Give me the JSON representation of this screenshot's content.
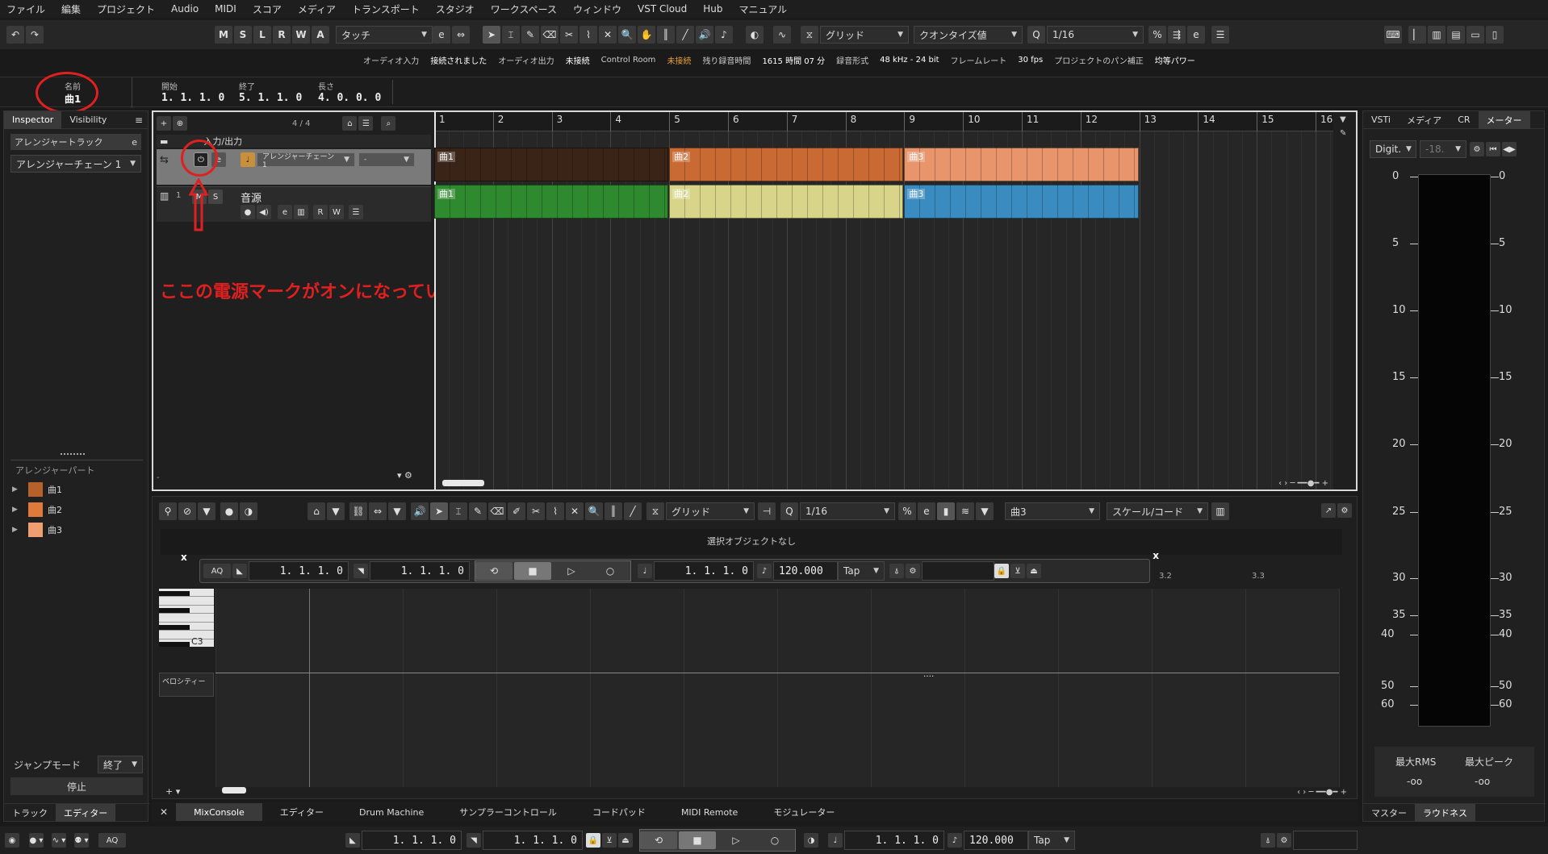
{
  "menu": [
    "ファイル",
    "編集",
    "プロジェクト",
    "Audio",
    "MIDI",
    "スコア",
    "メディア",
    "トランスポート",
    "スタジオ",
    "ワークスペース",
    "ウィンドウ",
    "VST Cloud",
    "Hub",
    "マニュアル"
  ],
  "toolbar": {
    "msrwa": [
      "M",
      "S",
      "L",
      "R",
      "W",
      "A"
    ],
    "touch": "タッチ",
    "grid": "グリッド",
    "quantize_type": "クオンタイズ値",
    "quantize": "1/16"
  },
  "status": {
    "audio_in_label": "オーディオ入力",
    "audio_in_value": "接続されました",
    "audio_out_label": "オーディオ出力",
    "audio_out_value": "未接続",
    "cr_label": "Control Room",
    "cr_value": "未接続",
    "rec_time_label": "残り録音時間",
    "rec_time_value": "1615 時間 07 分",
    "rec_format_label": "録音形式",
    "rec_format_value": "48 kHz - 24 bit",
    "frame_label": "フレームレート",
    "frame_value": "30 fps",
    "pan_label": "プロジェクトのパン補正",
    "pan_value": "均等パワー"
  },
  "infoline": {
    "name_label": "名前",
    "name_value": "曲1",
    "start_label": "開始",
    "start_value": "1. 1. 1.  0",
    "end_label": "終了",
    "end_value": "5. 1. 1.  0",
    "length_label": "長さ",
    "length_value": "4. 0. 0.  0"
  },
  "inspector": {
    "tab1": "Inspector",
    "tab2": "Visibility",
    "track_name": "アレンジャートラック",
    "chain": "アレンジャーチェーン 1",
    "parts_title": "アレンジャーパート",
    "parts": [
      "曲1",
      "曲2",
      "曲3"
    ],
    "part_colors": [
      "#b8602a",
      "#e07a3a",
      "#f0a070"
    ],
    "jump_label": "ジャンプモード",
    "jump_value": "終了",
    "stop": "停止",
    "bottom_tab1": "トラック",
    "bottom_tab2": "エディター"
  },
  "tracklist": {
    "counter": "4 / 4",
    "io_label": "入力/出力",
    "arranger_chain": "アレンジャーチェーン 1",
    "arranger_dash": "-",
    "track_num": "1",
    "track_name": "音源",
    "btn_m": "M",
    "btn_s": "S",
    "btn_r": "R",
    "btn_w": "W"
  },
  "ruler": [
    "1",
    "2",
    "3",
    "4",
    "5",
    "6",
    "7",
    "8",
    "9",
    "10",
    "11",
    "12",
    "13",
    "14",
    "15",
    "16"
  ],
  "clips_arranger": [
    {
      "label": "曲1",
      "color": "#3a2418"
    },
    {
      "label": "曲2",
      "color": "#c96a35"
    },
    {
      "label": "曲3",
      "color": "#e8956b"
    }
  ],
  "clips_midi": [
    {
      "label": "曲1",
      "color": "#2f8a2f"
    },
    {
      "label": "曲2",
      "color": "#d8d48a"
    },
    {
      "label": "曲3",
      "color": "#3a8cc0"
    }
  ],
  "annotation": {
    "text": "ここの電源マークがオンになっているかの確認",
    "color": "#e02020"
  },
  "editor": {
    "grid": "グリッド",
    "quantize": "1/16",
    "part": "曲3",
    "scale": "スケール/コード",
    "no_selection": "選択オブジェクトなし",
    "key_c3": "C3",
    "velocity": "ベロシティー",
    "ruler_a": "3.2",
    "ruler_b": "3.3"
  },
  "transport_float": {
    "aq": "AQ",
    "left": "1. 1. 1.   0",
    "right": "1. 1. 1.   0",
    "pos": "1. 1. 1.   0",
    "tempo": "120.000",
    "tap": "Tap"
  },
  "right_panel": {
    "tabs": [
      "VSTi",
      "メディア",
      "CR",
      "メーター"
    ],
    "mode": "Digit.",
    "peak": "-18.",
    "scale": [
      "0",
      "5",
      "10",
      "15",
      "20",
      "25",
      "30",
      "35",
      "40",
      "50",
      "60"
    ],
    "rms_label": "最大RMS",
    "rms_value": "-oo",
    "peak_label": "最大ピーク",
    "peak_value": "-oo",
    "bottom_tab1": "マスター",
    "bottom_tab2": "ラウドネス"
  },
  "bottom_tabs": [
    "MixConsole",
    "エディター",
    "Drum Machine",
    "サンプラーコントロール",
    "コードパッド",
    "MIDI Remote",
    "モジュレーター"
  ],
  "bottom_transport": {
    "aq": "AQ",
    "left": "1. 1. 1.   0",
    "right": "1. 1. 1.   0",
    "pos": "1. 1. 1.   0",
    "tempo": "120.000",
    "tap": "Tap"
  }
}
